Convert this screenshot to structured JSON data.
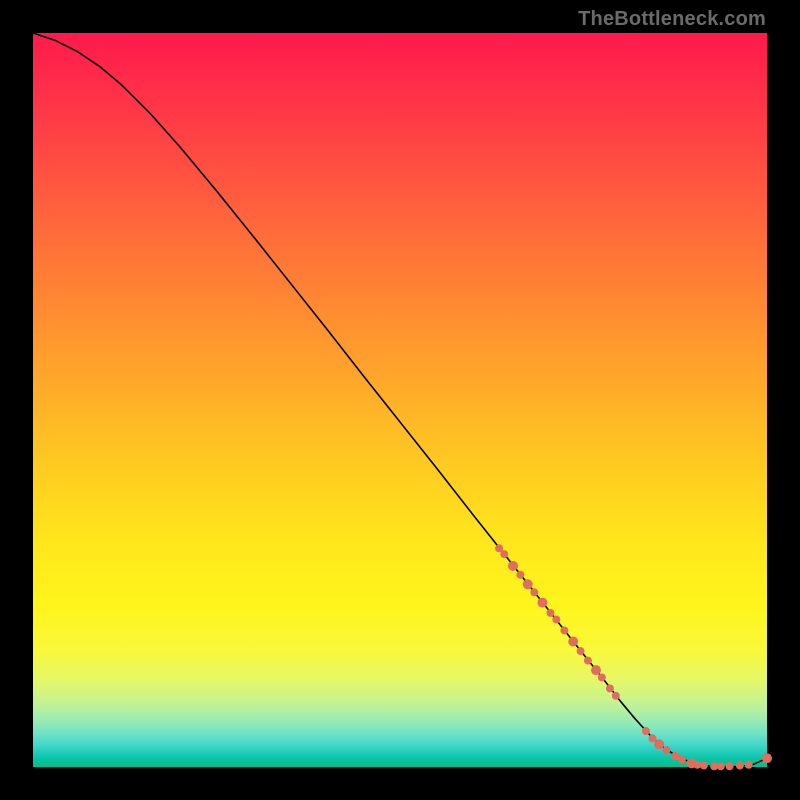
{
  "attribution": "TheBottleneck.com",
  "colors": {
    "marker": "#e06e5f",
    "curve": "#000000",
    "page_bg": "#000000"
  },
  "chart_data": {
    "type": "line",
    "title": "",
    "xlabel": "",
    "ylabel": "",
    "xlim": [
      0,
      100
    ],
    "ylim": [
      0,
      100
    ],
    "grid": false,
    "legend": false,
    "series": [
      {
        "name": "curve",
        "x": [
          0,
          3,
          6,
          9,
          12,
          16,
          20,
          25,
          30,
          35,
          40,
          45,
          50,
          55,
          60,
          65,
          70,
          74,
          78,
          80,
          82,
          84,
          86,
          88,
          90,
          92,
          94,
          96,
          98,
          100
        ],
        "y": [
          100,
          99,
          97.5,
          95.5,
          93,
          89,
          84.5,
          78.5,
          72.3,
          66,
          59.7,
          53.3,
          47,
          40.7,
          34.3,
          28,
          21.7,
          16.6,
          11.6,
          9,
          6.6,
          4.4,
          2.6,
          1.3,
          0.5,
          0.15,
          0.05,
          0.05,
          0.3,
          1.2
        ]
      }
    ],
    "markers": {
      "name": "dots",
      "points": [
        {
          "x": 63.5,
          "y": 29.8,
          "r": 4
        },
        {
          "x": 64.2,
          "y": 29.0,
          "r": 4
        },
        {
          "x": 65.4,
          "y": 27.4,
          "r": 5
        },
        {
          "x": 66.4,
          "y": 26.2,
          "r": 4
        },
        {
          "x": 67.4,
          "y": 24.9,
          "r": 5
        },
        {
          "x": 68.3,
          "y": 23.8,
          "r": 4
        },
        {
          "x": 69.4,
          "y": 22.4,
          "r": 5
        },
        {
          "x": 70.5,
          "y": 21.0,
          "r": 4
        },
        {
          "x": 71.3,
          "y": 20.1,
          "r": 4
        },
        {
          "x": 72.4,
          "y": 18.6,
          "r": 4
        },
        {
          "x": 73.6,
          "y": 17.1,
          "r": 5
        },
        {
          "x": 74.6,
          "y": 15.8,
          "r": 4
        },
        {
          "x": 75.6,
          "y": 14.5,
          "r": 4
        },
        {
          "x": 76.7,
          "y": 13.2,
          "r": 5
        },
        {
          "x": 77.5,
          "y": 12.2,
          "r": 4
        },
        {
          "x": 78.6,
          "y": 10.7,
          "r": 4
        },
        {
          "x": 79.4,
          "y": 9.7,
          "r": 4
        },
        {
          "x": 83.5,
          "y": 4.9,
          "r": 4
        },
        {
          "x": 84.4,
          "y": 3.9,
          "r": 4
        },
        {
          "x": 85.3,
          "y": 3.1,
          "r": 5
        },
        {
          "x": 86.3,
          "y": 2.3,
          "r": 4
        },
        {
          "x": 87.5,
          "y": 1.5,
          "r": 4
        },
        {
          "x": 88.4,
          "y": 1.0,
          "r": 4
        },
        {
          "x": 89.7,
          "y": 0.5,
          "r": 5
        },
        {
          "x": 90.5,
          "y": 0.3,
          "r": 4
        },
        {
          "x": 91.4,
          "y": 0.2,
          "r": 4
        },
        {
          "x": 92.8,
          "y": 0.1,
          "r": 4
        },
        {
          "x": 93.7,
          "y": 0.1,
          "r": 4
        },
        {
          "x": 94.9,
          "y": 0.1,
          "r": 4
        },
        {
          "x": 96.3,
          "y": 0.2,
          "r": 4
        },
        {
          "x": 97.5,
          "y": 0.3,
          "r": 4
        },
        {
          "x": 100.0,
          "y": 1.2,
          "r": 5
        }
      ]
    }
  }
}
